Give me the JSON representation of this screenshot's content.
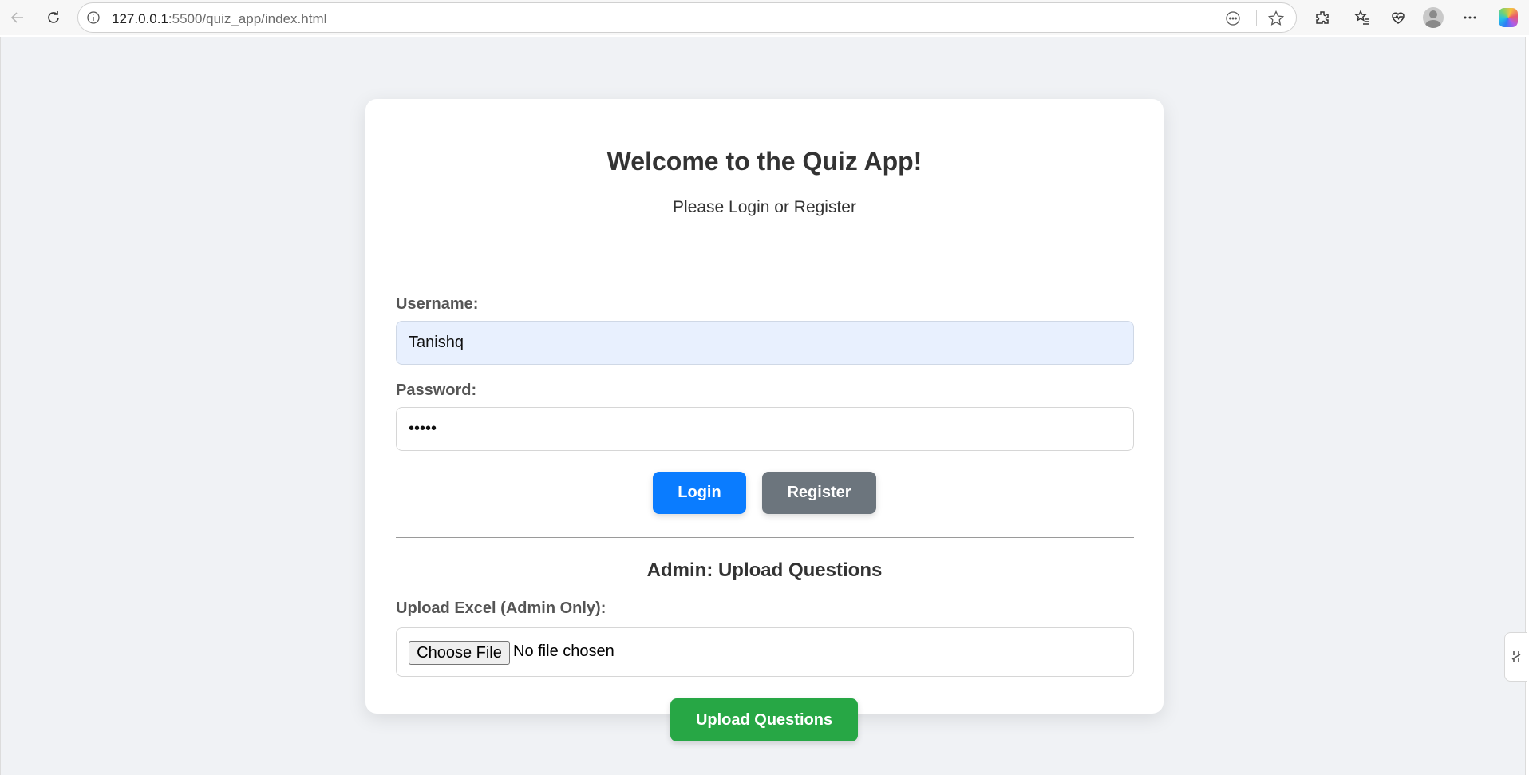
{
  "browser": {
    "url_host": "127.0.0.1",
    "url_path": ":5500/quiz_app/index.html"
  },
  "page": {
    "title": "Welcome to the Quiz App!",
    "subtitle": "Please Login or Register",
    "username_label": "Username:",
    "username_value": "Tanishq",
    "password_label": "Password:",
    "password_value": "•••••",
    "login_label": "Login",
    "register_label": "Register",
    "admin_title": "Admin: Upload Questions",
    "upload_label": "Upload Excel (Admin Only):",
    "choose_file_label": "Choose File",
    "no_file_text": "No file chosen",
    "upload_button_label": "Upload Questions"
  },
  "colors": {
    "login": "#0a7cff",
    "register": "#6c757d",
    "upload": "#27a745",
    "background": "#f0f2f5"
  },
  "icons": [
    "back-icon",
    "reload-icon",
    "info-icon",
    "reader-icon",
    "star-icon",
    "extensions-icon",
    "favorites-icon",
    "health-icon",
    "profile-avatar",
    "more-icon",
    "copilot-icon"
  ]
}
